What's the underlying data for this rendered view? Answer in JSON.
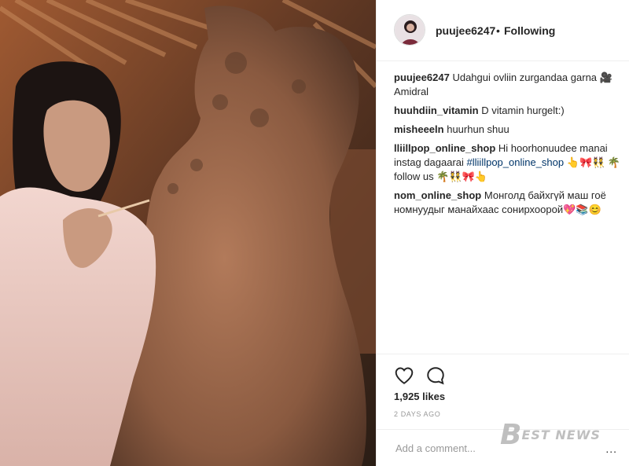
{
  "header": {
    "username": "puujee6247",
    "separator": "•",
    "follow_status": "Following"
  },
  "comments": [
    {
      "user": "puujee6247",
      "text": "Udahgui ovliin zurgandaa garna 🎥Amidral"
    },
    {
      "user": "huuhdiin_vitamin",
      "text": "D vitamin hurgelt:)"
    },
    {
      "user": "misheeeln",
      "text": "huurhun shuu"
    },
    {
      "user": "lliillpop_online_shop",
      "text": "Hi hoorhonuudee manai instag dagaarai",
      "tag": "#lliillpop_online_shop",
      "text_after": "👆🎀👯 🌴follow us 🌴👯🎀👆"
    },
    {
      "user": "nom_online_shop",
      "text": "Монголд байхгүй маш гоё номнуудыг манайхаас сонирхоорой💖📚😊"
    }
  ],
  "actions": {
    "like_icon": "heart-icon",
    "comment_icon": "comment-icon"
  },
  "likes": "1,925 likes",
  "timestamp": "2 DAYS AGO",
  "comment_input": {
    "placeholder": "Add a comment..."
  },
  "more_options": "...",
  "watermark": {
    "letter": "B",
    "rest": "EST NEWS"
  },
  "colors": {
    "link": "#003569",
    "border": "#efefef",
    "muted": "#999999"
  }
}
